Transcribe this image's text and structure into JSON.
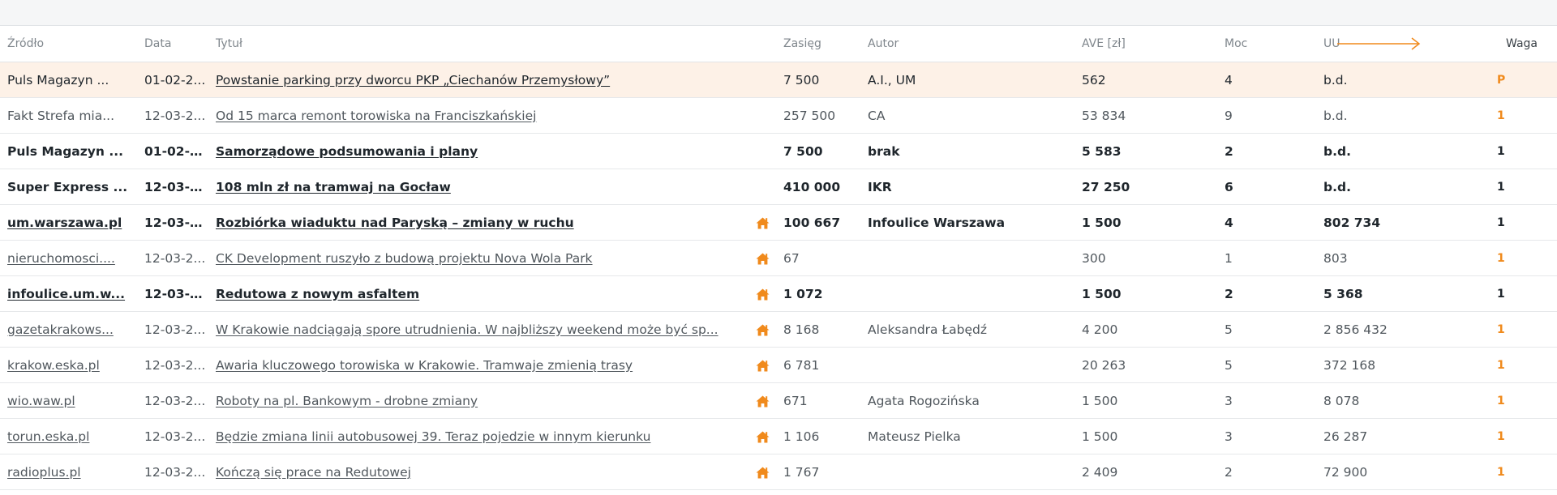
{
  "table": {
    "headers": {
      "source": "Źródło",
      "date": "Data",
      "title": "Tytuł",
      "reach": "Zasięg",
      "author": "Autor",
      "ave": "AVE [zł]",
      "moc": "Moc",
      "uu": "UU",
      "waga": "Waga"
    },
    "rows": [
      {
        "source": "Puls Magazyn ...",
        "date": "01-02-2...",
        "title": "Powstanie parking przy dworcu PKP „Ciechanów Przemysłowy”",
        "home": false,
        "reach": "7 500",
        "author": "A.I., UM",
        "ave": "562",
        "moc": "4",
        "uu": "b.d.",
        "waga": "P"
      },
      {
        "source": "Fakt Strefa mia...",
        "date": "12-03-2...",
        "title": "Od 15 marca remont torowiska na Franciszkańskiej",
        "home": false,
        "reach": "257 500",
        "author": "CA",
        "ave": "53 834",
        "moc": "9",
        "uu": "b.d.",
        "waga": "1"
      },
      {
        "source": "Puls Magazyn ...",
        "date": "01-02-2...",
        "title": "Samorządowe podsumowania i plany",
        "home": false,
        "reach": "7 500",
        "author": "brak",
        "ave": "5 583",
        "moc": "2",
        "uu": "b.d.",
        "waga": "1"
      },
      {
        "source": "Super Express ...",
        "date": "12-03-2...",
        "title": "108 mln zł na tramwaj na Gocław",
        "home": false,
        "reach": "410 000",
        "author": "IKR",
        "ave": "27 250",
        "moc": "6",
        "uu": "b.d.",
        "waga": "1"
      },
      {
        "source": "um.warszawa.pl",
        "date": "12-03-2...",
        "title": "Rozbiórka wiaduktu nad Paryską – zmiany w ruchu",
        "home": true,
        "reach": "100 667",
        "author": "Infoulice Warszawa",
        "ave": "1 500",
        "moc": "4",
        "uu": "802 734",
        "waga": "1"
      },
      {
        "source": "nieruchomosci....",
        "date": "12-03-2...",
        "title": "CK Development ruszyło z budową projektu Nova Wola Park",
        "home": true,
        "reach": "67",
        "author": "",
        "ave": "300",
        "moc": "1",
        "uu": "803",
        "waga": "1"
      },
      {
        "source": "infoulice.um.w...",
        "date": "12-03-2...",
        "title": "Redutowa z nowym asfaltem",
        "home": true,
        "reach": "1 072",
        "author": "",
        "ave": "1 500",
        "moc": "2",
        "uu": "5 368",
        "waga": "1"
      },
      {
        "source": "gazetakrakows...",
        "date": "12-03-2...",
        "title": "W Krakowie nadciągają spore utrudnienia. W najbliższy weekend może być sp...",
        "home": true,
        "reach": "8 168",
        "author": "Aleksandra Łabędź",
        "ave": "4 200",
        "moc": "5",
        "uu": "2 856 432",
        "waga": "1"
      },
      {
        "source": "krakow.eska.pl",
        "date": "12-03-2...",
        "title": "Awaria kluczowego torowiska w Krakowie. Tramwaje zmienią trasy",
        "home": true,
        "reach": "6 781",
        "author": "",
        "ave": "20 263",
        "moc": "5",
        "uu": "372 168",
        "waga": "1"
      },
      {
        "source": "wio.waw.pl",
        "date": "12-03-2...",
        "title": "Roboty na pl. Bankowym - drobne zmiany",
        "home": true,
        "reach": "671",
        "author": "Agata Rogozińska",
        "ave": "1 500",
        "moc": "3",
        "uu": "8 078",
        "waga": "1"
      },
      {
        "source": "torun.eska.pl",
        "date": "12-03-2...",
        "title": "Będzie zmiana linii autobusowej 39. Teraz pojedzie w innym kierunku",
        "home": true,
        "reach": "1 106",
        "author": "Mateusz Pielka",
        "ave": "1 500",
        "moc": "3",
        "uu": "26 287",
        "waga": "1"
      },
      {
        "source": "radioplus.pl",
        "date": "12-03-2...",
        "title": "Kończą się prace na Redutowej",
        "home": true,
        "reach": "1 767",
        "author": "",
        "ave": "2 409",
        "moc": "2",
        "uu": "72 900",
        "waga": "1"
      }
    ],
    "row_styles": [
      "highlight",
      "normal",
      "bold",
      "bold",
      "bold",
      "normal",
      "bold",
      "normal",
      "normal",
      "normal",
      "normal",
      "normal"
    ],
    "source_is_link": [
      false,
      false,
      false,
      false,
      true,
      true,
      true,
      true,
      true,
      true,
      true,
      true
    ]
  },
  "icons": {
    "home": "home-icon",
    "sort_arrow": "arrow-right-icon"
  },
  "colors": {
    "accent": "#f08a1c",
    "highlight_row": "#fdf1e7"
  }
}
